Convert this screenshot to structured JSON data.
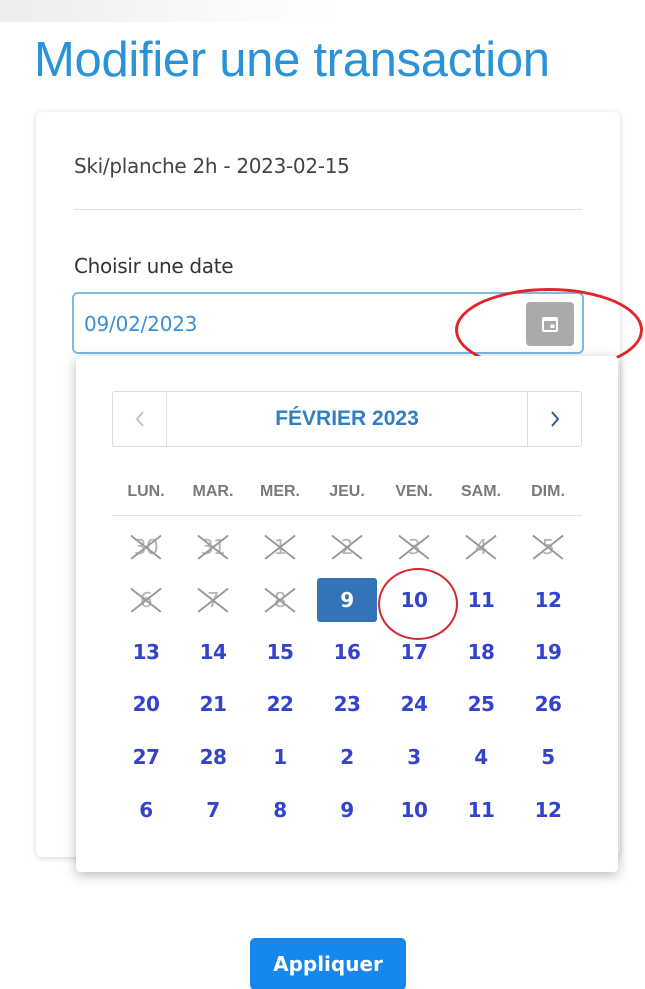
{
  "page": {
    "title": "Modifier une transaction"
  },
  "transaction": {
    "label": "Ski/planche 2h - 2023-02-15"
  },
  "date_field": {
    "label": "Choisir une date",
    "value": "09/02/2023",
    "button_icon": "calendar-icon"
  },
  "datepicker": {
    "month_label": "FÉVRIER 2023",
    "prev_icon": "chevron-left-icon",
    "next_icon": "chevron-right-icon",
    "weekdays": [
      "LUN.",
      "MAR.",
      "MER.",
      "JEU.",
      "VEN.",
      "SAM.",
      "DIM."
    ],
    "selected_day": "9",
    "colors": {
      "selected_bg": "#3373b7",
      "day_text": "#3344cc",
      "disabled_text": "#b5b5b5"
    },
    "weeks": [
      [
        {
          "day": "30",
          "disabled": true
        },
        {
          "day": "31",
          "disabled": true
        },
        {
          "day": "1",
          "disabled": true
        },
        {
          "day": "2",
          "disabled": true
        },
        {
          "day": "3",
          "disabled": true
        },
        {
          "day": "4",
          "disabled": true
        },
        {
          "day": "5",
          "disabled": true
        }
      ],
      [
        {
          "day": "6",
          "disabled": true
        },
        {
          "day": "7",
          "disabled": true
        },
        {
          "day": "8",
          "disabled": true
        },
        {
          "day": "9",
          "selected": true
        },
        {
          "day": "10"
        },
        {
          "day": "11"
        },
        {
          "day": "12"
        }
      ],
      [
        {
          "day": "13"
        },
        {
          "day": "14"
        },
        {
          "day": "15"
        },
        {
          "day": "16"
        },
        {
          "day": "17"
        },
        {
          "day": "18"
        },
        {
          "day": "19"
        }
      ],
      [
        {
          "day": "20"
        },
        {
          "day": "21"
        },
        {
          "day": "22"
        },
        {
          "day": "23"
        },
        {
          "day": "24"
        },
        {
          "day": "25"
        },
        {
          "day": "26"
        }
      ],
      [
        {
          "day": "27"
        },
        {
          "day": "28"
        },
        {
          "day": "1"
        },
        {
          "day": "2"
        },
        {
          "day": "3"
        },
        {
          "day": "4"
        },
        {
          "day": "5"
        }
      ],
      [
        {
          "day": "6"
        },
        {
          "day": "7"
        },
        {
          "day": "8"
        },
        {
          "day": "9"
        },
        {
          "day": "10"
        },
        {
          "day": "11"
        },
        {
          "day": "12"
        }
      ]
    ]
  },
  "actions": {
    "apply_label": "Appliquer"
  },
  "colors": {
    "title": "#2a93d8",
    "primary_button": "#1787f0",
    "annotation": "#e3242b"
  }
}
